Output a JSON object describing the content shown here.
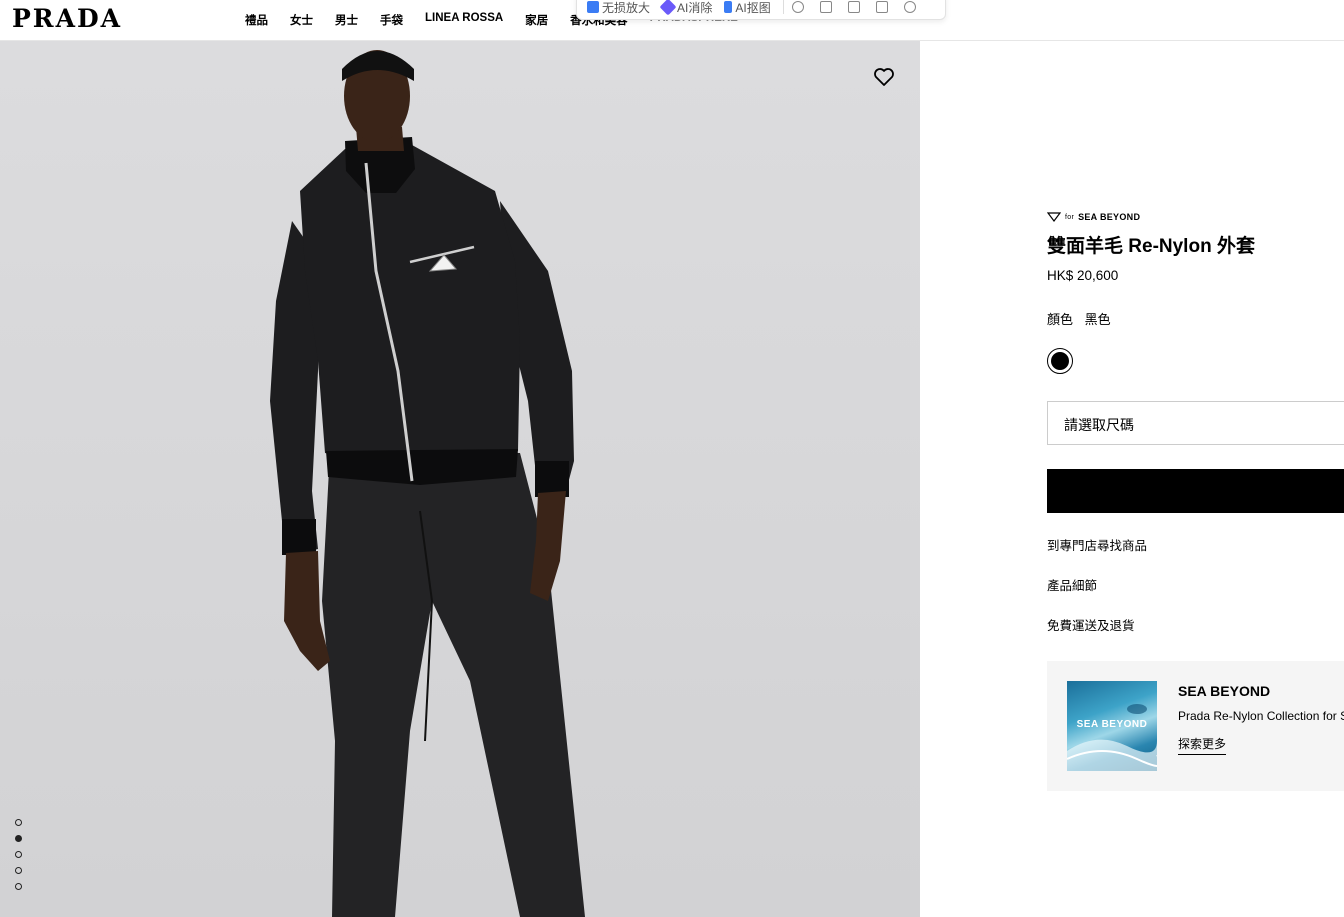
{
  "header": {
    "logo": "PRADA",
    "nav": [
      {
        "label": "禮品"
      },
      {
        "label": "女士"
      },
      {
        "label": "男士"
      },
      {
        "label": "手袋"
      },
      {
        "label": "LINEA ROSSA"
      },
      {
        "label": "家居"
      },
      {
        "label": "香水和美容"
      },
      {
        "label": "PRADASPHERE"
      }
    ]
  },
  "ext_toolbar": {
    "items": [
      {
        "label": "无损放大",
        "icon": "image-upscale-icon",
        "color": "#3b7cf4"
      },
      {
        "label": "AI消除",
        "icon": "eraser-icon",
        "color": "#6a5af9"
      },
      {
        "label": "AI抠图",
        "icon": "cutout-icon",
        "color": "#3b7cf4"
      }
    ],
    "tool_icons": [
      "bulb-icon",
      "image-icon",
      "crop-icon",
      "download-icon",
      "settings-icon"
    ]
  },
  "gallery": {
    "image_alt": "Model wearing black Re-Nylon jacket and black trousers",
    "dots": [
      {
        "active": false
      },
      {
        "active": true
      },
      {
        "active": false
      },
      {
        "active": false
      },
      {
        "active": false
      }
    ]
  },
  "product": {
    "brand_for": "for",
    "brand_name": "SEA BEYOND",
    "title": "雙面羊毛 Re-Nylon 外套",
    "price": "HK$ 20,600",
    "color_label": "顏色",
    "color_value": "黑色",
    "size_placeholder": "請選取尺碼",
    "links": [
      "到專門店尋找商品",
      "產品細節",
      "免費運送及退貨"
    ]
  },
  "sea_card": {
    "thumb_label": "SEA BEYOND",
    "title": "SEA BEYOND",
    "desc": "Prada Re-Nylon Collection for S",
    "link": "探索更多"
  },
  "colors": {
    "jacket": "#1d1d1f",
    "background": "#d8d8da",
    "skin": "#3a2418"
  }
}
